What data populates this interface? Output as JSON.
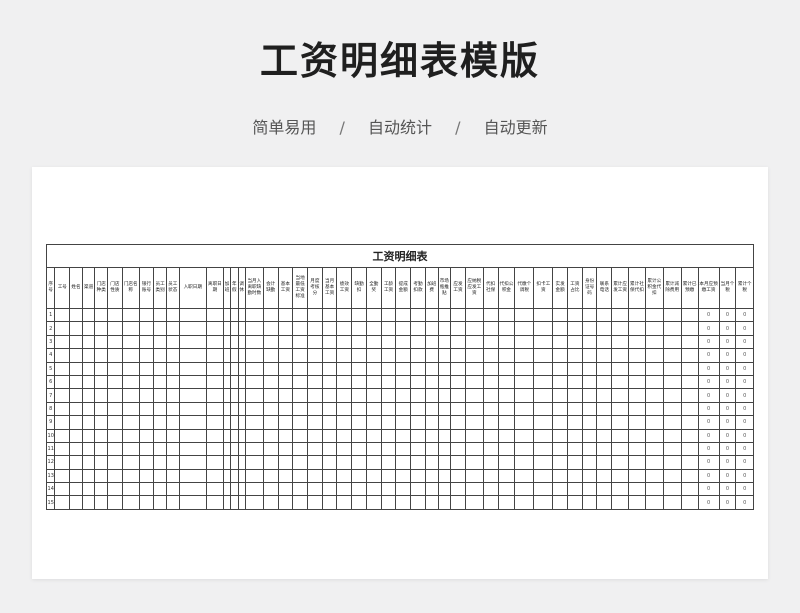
{
  "hero": {
    "title": "工资明细表模版",
    "tags": [
      "简单易用",
      "自动统计",
      "自动更新"
    ],
    "separator": "/"
  },
  "table": {
    "title": "工资明细表",
    "columns": [
      "序号",
      "工号",
      "姓名",
      "渠道",
      "门店种类",
      "门店性质",
      "门店名称",
      "银行账号",
      "员工类别",
      "员工状态",
      "入职日期",
      "离职日期",
      "加班",
      "年假",
      "调休",
      "当月入离职缺勤时数",
      "会计缺勤",
      "基本工资",
      "当地最低工资标准",
      "月度考核分",
      "当月基本工资",
      "绩效工资",
      "缺勤扣",
      "全勤奖",
      "工龄工资",
      "提成金额",
      "考勤扣款",
      "加班费",
      "市场瓶推贴",
      "应发工资",
      "应纳税应发工资",
      "代扣社保",
      "代扣公积金",
      "代缴个调税",
      "扣卡工资",
      "实发金额",
      "工资占比",
      "身份证号码",
      "联系电话",
      "累计应发工资",
      "累计社保代扣",
      "累计公积金代扣",
      "累计减除费用",
      "累计已预缴",
      "本月应预缴工资",
      "当月个税",
      "累计个税"
    ],
    "row_numbers": [
      "1",
      "2",
      "3",
      "4",
      "5",
      "6",
      "7",
      "8",
      "9",
      "10",
      "11",
      "12",
      "13",
      "14",
      "15"
    ],
    "zero_value": "0",
    "zero_columns": [
      44,
      45,
      46
    ]
  }
}
